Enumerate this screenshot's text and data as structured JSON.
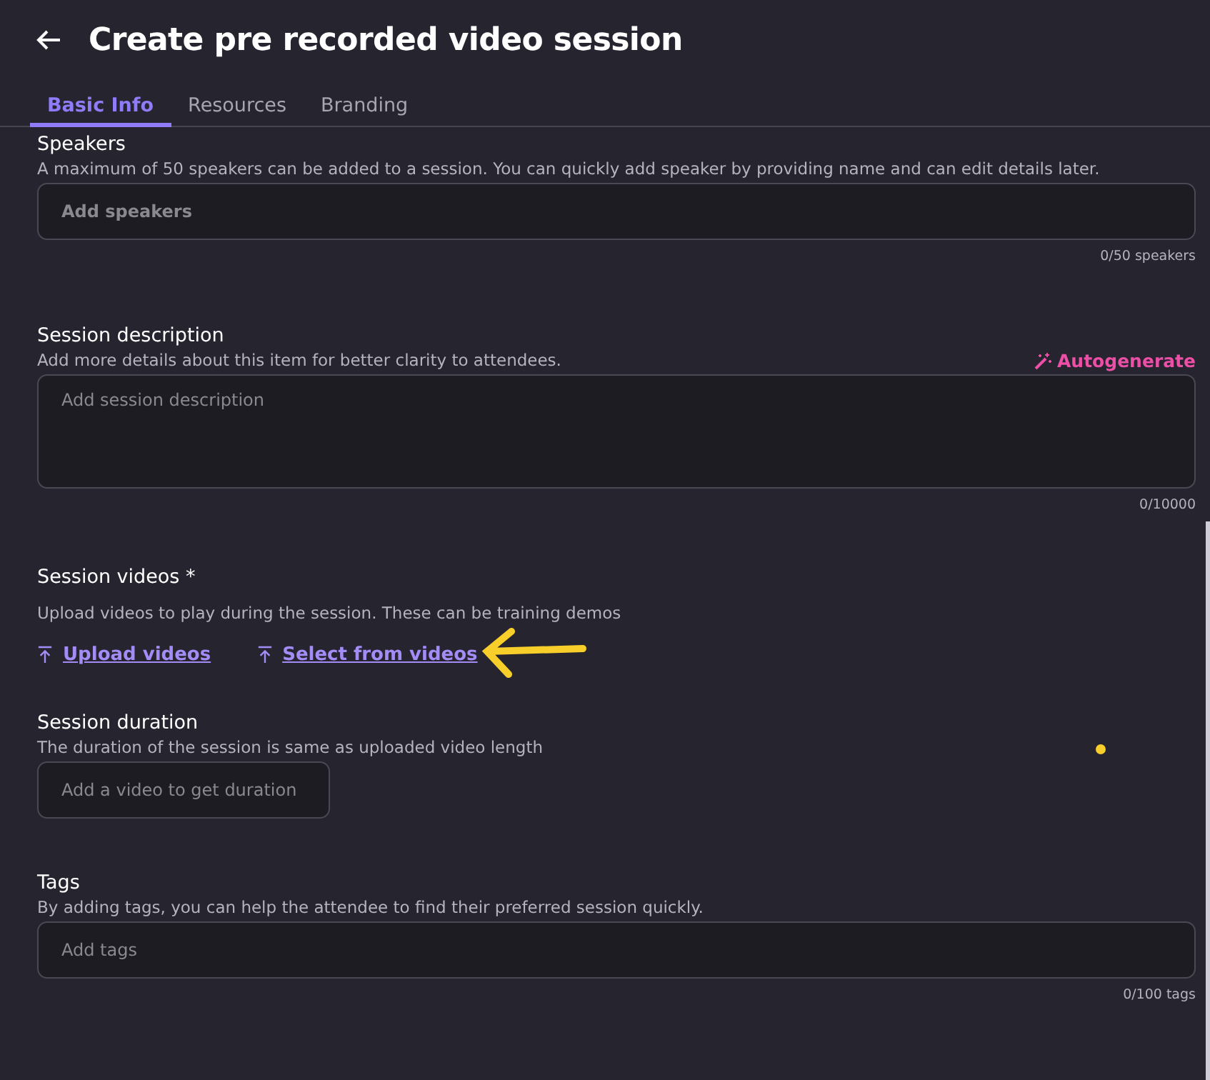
{
  "header": {
    "title": "Create pre recorded video session"
  },
  "tabs": [
    {
      "label": "Basic Info",
      "selected": true
    },
    {
      "label": "Resources",
      "selected": false
    },
    {
      "label": "Branding",
      "selected": false
    }
  ],
  "sections": [
    {
      "kind": "input",
      "title": "Speakers",
      "description": "A maximum of 50 speakers can be added to a session. You can quickly add speaker by providing name and can edit details later.",
      "placeholder": "Add speakers",
      "counter": "0/50 speakers"
    },
    {
      "kind": "textarea",
      "title": "Session description",
      "description": "Add more details about this item for better clarity to attendees.",
      "action": "Autogenerate",
      "placeholder": "Add session description",
      "counter": "0/10000"
    },
    {
      "kind": "links",
      "title": "Session videos *",
      "description": "Upload videos to play during the session. These can be training demos",
      "links": [
        "Upload videos",
        "Select from videos"
      ]
    },
    {
      "kind": "short",
      "title": "Session duration",
      "description": "The duration of the session is same as uploaded video length",
      "placeholder": "Add a video to get duration"
    },
    {
      "kind": "input",
      "title": "Tags",
      "description": "By adding tags, you can help the attendee to find their preferred session quickly.",
      "placeholder": "Add tags",
      "counter": "0/100 tags"
    }
  ]
}
